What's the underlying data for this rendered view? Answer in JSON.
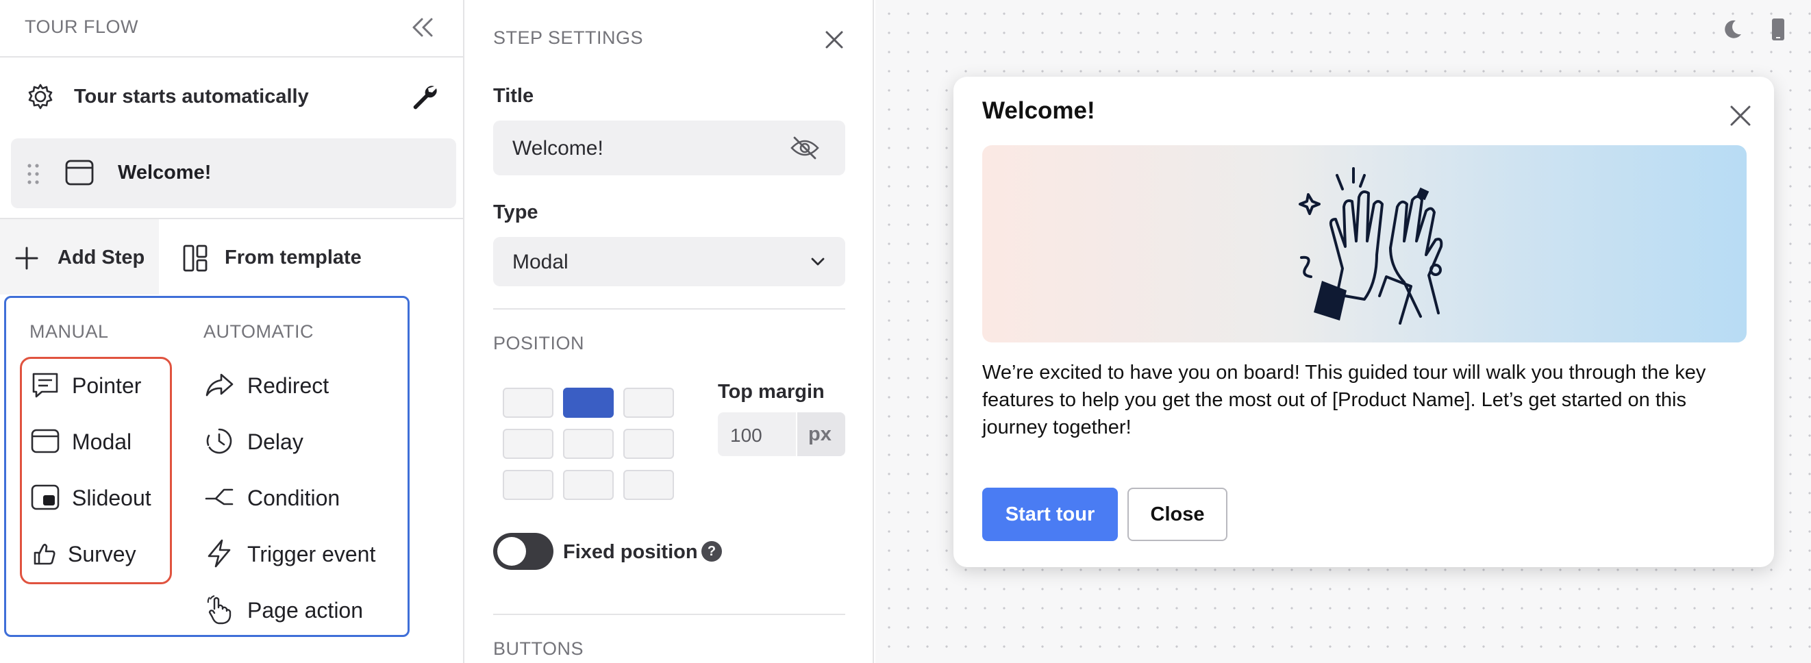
{
  "left_panel": {
    "title": "TOUR FLOW",
    "collapse_icon": "double-chevron-left-icon",
    "autostart_label": "Tour starts automatically",
    "steps": [
      {
        "label": "Welcome!",
        "icon": "modal-icon"
      }
    ],
    "add_step_label": "Add Step",
    "from_template_label": "From template",
    "menu": {
      "manual_title": "MANUAL",
      "automatic_title": "AUTOMATIC",
      "manual_items": [
        {
          "label": "Pointer",
          "icon": "pointer-icon"
        },
        {
          "label": "Modal",
          "icon": "modal-icon"
        },
        {
          "label": "Slideout",
          "icon": "slideout-icon"
        },
        {
          "label": "Survey",
          "icon": "survey-icon"
        }
      ],
      "automatic_items": [
        {
          "label": "Redirect",
          "icon": "redirect-icon"
        },
        {
          "label": "Delay",
          "icon": "delay-icon"
        },
        {
          "label": "Condition",
          "icon": "condition-icon"
        },
        {
          "label": "Trigger event",
          "icon": "trigger-event-icon"
        },
        {
          "label": "Page action",
          "icon": "page-action-icon"
        }
      ]
    },
    "colors": {
      "menu_border": "#3f6fd8",
      "manual_highlight": "#e0533f"
    }
  },
  "step_settings": {
    "title": "STEP SETTINGS",
    "title_label": "Title",
    "title_value": "Welcome!",
    "type_label": "Type",
    "type_value": "Modal",
    "position_title": "POSITION",
    "position_selected": "top-center",
    "top_margin_label": "Top margin",
    "top_margin_value": "100",
    "top_margin_unit": "px",
    "fixed_position_label": "Fixed position",
    "fixed_position_on": false,
    "help_glyph": "?",
    "buttons_title": "BUTTONS"
  },
  "preview": {
    "modal_title": "Welcome!",
    "body": "We’re excited to have you on board! This guided tour will walk you through the key features to help you get the most out of [Product Name]. Let’s get started on this journey together!",
    "start_button": "Start tour",
    "close_button": "Close",
    "illustration": "high-five-illustration",
    "colors": {
      "primary": "#4a7cf3"
    }
  }
}
